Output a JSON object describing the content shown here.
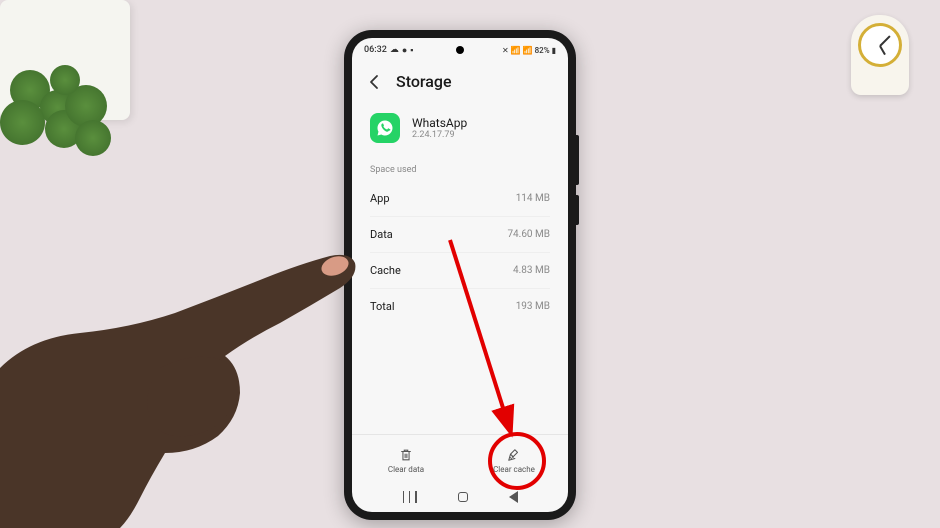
{
  "status": {
    "time": "06:32",
    "battery": "82%"
  },
  "header": {
    "title": "Storage"
  },
  "app": {
    "name": "WhatsApp",
    "version": "2.24.17.79"
  },
  "section": {
    "label": "Space used"
  },
  "rows": [
    {
      "label": "App",
      "value": "114 MB"
    },
    {
      "label": "Data",
      "value": "74.60 MB"
    },
    {
      "label": "Cache",
      "value": "4.83 MB"
    },
    {
      "label": "Total",
      "value": "193 MB"
    }
  ],
  "actions": {
    "clear_data": "Clear data",
    "clear_cache": "Clear cache"
  }
}
